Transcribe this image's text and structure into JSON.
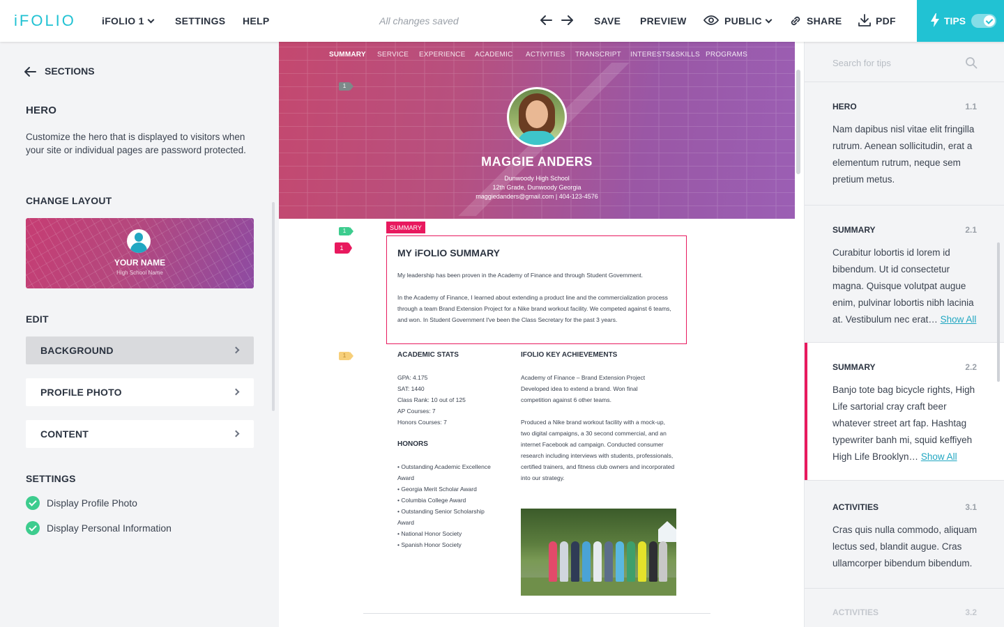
{
  "topbar": {
    "logo": "iFOLIO",
    "folio_menu": "iFOLIO 1",
    "settings": "SETTINGS",
    "help": "HELP",
    "status": "All changes saved",
    "save": "SAVE",
    "preview": "PREVIEW",
    "public": "PUBLIC",
    "share": "SHARE",
    "pdf": "PDF",
    "tips": "TIPS",
    "tips_on": true,
    "accent": "#21c2d3"
  },
  "left": {
    "back": "SECTIONS",
    "title": "HERO",
    "description": "Customize the hero that is displayed to visitors when your site or individual pages are password protected.",
    "change_layout": "CHANGE LAYOUT",
    "layout_thumb": {
      "name": "YOUR NAME",
      "school": "High School Name"
    },
    "edit": "EDIT",
    "edit_items": [
      "BACKGROUND",
      "PROFILE PHOTO",
      "CONTENT"
    ],
    "settings": "SETTINGS",
    "setting_items": [
      "Display Profile Photo",
      "Display Personal Information"
    ]
  },
  "preview": {
    "nav": [
      "SUMMARY",
      "SERVICE",
      "EXPERIENCE",
      "ACADEMIC",
      "ACTIVITIES",
      "TRANSCRIPT",
      "INTERESTS&SKILLS",
      "PROGRAMS"
    ],
    "name": "MAGGIE ANDERS",
    "school": "Dunwoody High School",
    "grade": "12th Grade, Dunwoody Georgia",
    "contact": "maggiedanders@gmail.com  |  404-123-4576",
    "badges": {
      "hero": "1",
      "summary_green": "1",
      "summary_pink": "1",
      "stats": "1"
    },
    "summary_tag": "SUMMARY",
    "summary_title": "MY iFOLIO SUMMARY",
    "summary_p1": "My leadership has been proven in the Academy of Finance and through Student Government.",
    "summary_p2": "In the Academy of Finance, I learned about extending a product line and the commercialization process through a team Brand Extension Project for a Nike brand workout facility. We competed against 6 teams, and won. In Student Government I've been the Class Secretary for the past 3 years.",
    "stats_title": "ACADEMIC STATS",
    "stats": [
      "GPA: 4.175",
      "SAT: 1440",
      "Class Rank: 10 out of 125",
      "AP Courses: 7",
      "Honors Courses: 7"
    ],
    "honors_title": "HONORS",
    "honors": [
      "• Outstanding Academic Excellence Award",
      "• Georgia Merit Scholar Award",
      "• Columbia College Award",
      "• Outstanding Senior Scholarship Award",
      "• National Honor Society",
      "• Spanish Honor Society"
    ],
    "achievements_title": "IFOLIO KEY ACHIEVEMENTS",
    "achievements_p1": "Academy of Finance – Brand Extension Project Developed idea to extend a brand.  Won final competition against 6 other teams.",
    "achievements_p2": "Produced a Nike brand workout facility with a mock-up, two digital campaigns, a 30 second commercial, and an internet Facebook ad campaign. Conducted consumer research including interviews with students, professionals, certified trainers, and fitness club owners and incorporated into our strategy."
  },
  "tips": {
    "search_placeholder": "Search for tips",
    "items": [
      {
        "title": "HERO",
        "num": "1.1",
        "body": "Nam dapibus nisl vitae elit fringilla rutrum. Aenean sollicitudin, erat a elementum rutrum, neque sem pretium metus.",
        "more": ""
      },
      {
        "title": "SUMMARY",
        "num": "2.1",
        "body": "Curabitur lobortis id lorem id bibendum. Ut id consectetur magna. Quisque volutpat augue enim, pulvinar lobortis nibh lacinia at. Vestibulum nec erat…",
        "more": "Show All"
      },
      {
        "title": "SUMMARY",
        "num": "2.2",
        "body": "Banjo tote bag bicycle rights, High Life sartorial cray craft beer whatever street art fap. Hashtag typewriter banh mi, squid keffiyeh High Life Brooklyn…",
        "more": "Show All"
      },
      {
        "title": "ACTIVITIES",
        "num": "3.1",
        "body": "Cras quis nulla commodo, aliquam lectus sed, blandit augue. Cras ullamcorper bibendum bibendum.",
        "more": ""
      },
      {
        "title": "ACTIVITIES",
        "num": "3.2",
        "body": "",
        "more": ""
      }
    ]
  }
}
